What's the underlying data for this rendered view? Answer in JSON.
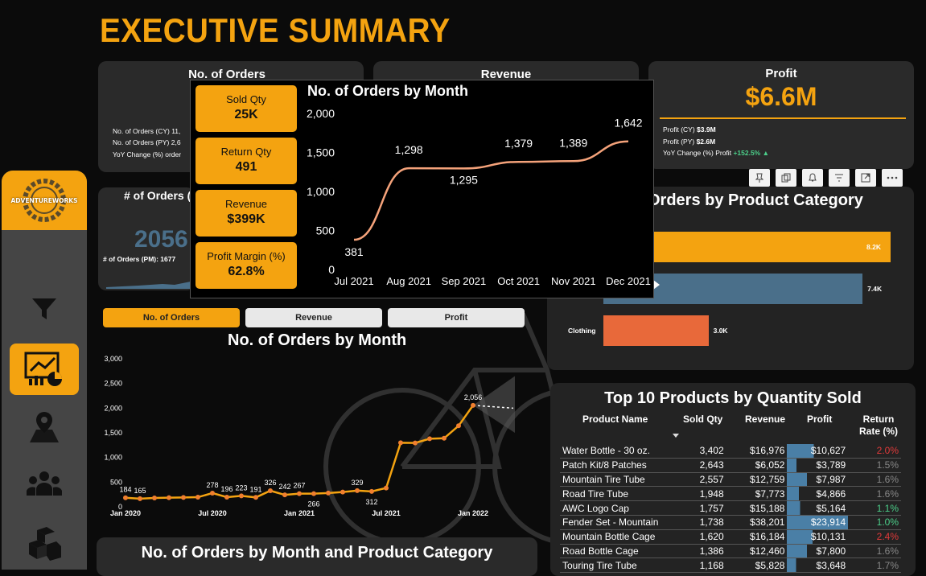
{
  "page_title": "EXECUTIVE SUMMARY",
  "cards": {
    "orders": {
      "title": "No. of Orders",
      "cy": "No. of Orders (CY) 11,",
      "py": "No. of Orders (PY) 2,6",
      "yoy": "YoY Change (%) order"
    },
    "revenue": {
      "title": "Revenue"
    },
    "profit": {
      "title": "Profit",
      "value": "$6.6M",
      "cy_label": "Profit (CY)",
      "cy_value": "$3.9M",
      "py_label": "Profit (PY)",
      "py_value": "$2.6M",
      "yoy_label": "YoY Change (%) Profit",
      "yoy_value": "+152.5% ▲"
    }
  },
  "month_card": {
    "title": "# of Orders (",
    "value": "2056",
    "pm": "# of Orders (PM): 1677"
  },
  "tooltip": {
    "kpis": [
      {
        "label": "Sold Qty",
        "value": "25K"
      },
      {
        "label": "Return Qty",
        "value": "491"
      },
      {
        "label": "Revenue",
        "value": "$399K"
      },
      {
        "label": "Profit Margin (%)",
        "value": "62.8%"
      }
    ]
  },
  "tabs": [
    {
      "label": "No. of Orders",
      "active": true
    },
    {
      "label": "Revenue",
      "active": false
    },
    {
      "label": "Profit",
      "active": false
    }
  ],
  "category_chart": {
    "title": "Orders by Product Category",
    "bars": [
      {
        "label": "",
        "value_label": "8.2K",
        "value": 8.2,
        "color": "#f4a310"
      },
      {
        "label": "",
        "value_label": "7.4K",
        "value": 7.4,
        "color": "#4a6f8a"
      },
      {
        "label": "Clothing",
        "value_label": "3.0K",
        "value": 3.0,
        "color": "#e8693a"
      }
    ]
  },
  "bottom_title": "No. of Orders by Month and Product Category",
  "top_products": {
    "title": "Top 10 Products by Quantity Sold",
    "headers": [
      "Product Name",
      "Sold Qty",
      "Revenue",
      "Profit",
      "Return Rate (%)"
    ],
    "rows": [
      {
        "name": "Water Bottle - 30 oz.",
        "qty": "3,402",
        "revenue": "$16,976",
        "profit": "$10,627",
        "profit_value": 10627,
        "rate": "2.0%",
        "rate_color": "#e03a3a"
      },
      {
        "name": "Patch Kit/8 Patches",
        "qty": "2,643",
        "revenue": "$6,052",
        "profit": "$3,789",
        "profit_value": 3789,
        "rate": "1.5%",
        "rate_color": "#888888"
      },
      {
        "name": "Mountain Tire Tube",
        "qty": "2,557",
        "revenue": "$12,759",
        "profit": "$7,987",
        "profit_value": 7987,
        "rate": "1.6%",
        "rate_color": "#888888"
      },
      {
        "name": "Road Tire Tube",
        "qty": "1,948",
        "revenue": "$7,773",
        "profit": "$4,866",
        "profit_value": 4866,
        "rate": "1.6%",
        "rate_color": "#888888"
      },
      {
        "name": "AWC Logo Cap",
        "qty": "1,757",
        "revenue": "$15,188",
        "profit": "$5,164",
        "profit_value": 5164,
        "rate": "1.1%",
        "rate_color": "#4ccf8a"
      },
      {
        "name": "Fender Set - Mountain",
        "qty": "1,738",
        "revenue": "$38,201",
        "profit": "$23,914",
        "profit_value": 23914,
        "rate": "1.0%",
        "rate_color": "#4ccf8a"
      },
      {
        "name": "Mountain Bottle Cage",
        "qty": "1,620",
        "revenue": "$16,184",
        "profit": "$10,131",
        "profit_value": 10131,
        "rate": "2.4%",
        "rate_color": "#e03a3a"
      },
      {
        "name": "Road Bottle Cage",
        "qty": "1,386",
        "revenue": "$12,460",
        "profit": "$7,800",
        "profit_value": 7800,
        "rate": "1.6%",
        "rate_color": "#888888"
      },
      {
        "name": "Touring Tire Tube",
        "qty": "1,168",
        "revenue": "$5,828",
        "profit": "$3,648",
        "profit_value": 3648,
        "rate": "1.7%",
        "rate_color": "#888888"
      }
    ]
  },
  "icons": {
    "filter": "filter-icon",
    "dashboard": "dashboard-icon",
    "map": "map-pin-icon",
    "customers": "people-icon",
    "products": "boxes-icon"
  },
  "logo_text": "ADVENTUREWORKS",
  "colors": {
    "accent": "#f4a310",
    "line_orange": "#f07f2f",
    "card_bg": "#2a2a2a"
  },
  "chart_data": [
    {
      "type": "line",
      "title": "No. of Orders by Month",
      "categories": [
        "Jul 2021",
        "Aug 2021",
        "Sep 2021",
        "Oct 2021",
        "Nov 2021",
        "Dec 2021"
      ],
      "values": [
        381,
        1298,
        1295,
        1379,
        1389,
        1642
      ],
      "yticks": [
        "0",
        "500",
        "1,000",
        "1,500",
        "2,000"
      ],
      "ylim": [
        0,
        2000
      ]
    },
    {
      "type": "line",
      "title": "No. of Orders by Month",
      "x_ticks": [
        "Jan 2020",
        "Jul 2020",
        "Jan 2021",
        "Jul 2021",
        "Jan 2022"
      ],
      "yticks": [
        "0",
        "500",
        "1,000",
        "1,500",
        "2,000",
        "2,500",
        "3,000"
      ],
      "ylim": [
        0,
        3000
      ],
      "values": [
        184,
        165,
        180,
        185,
        190,
        195,
        278,
        196,
        223,
        191,
        326,
        242,
        267,
        266,
        280,
        300,
        329,
        312,
        381,
        1298,
        1295,
        1379,
        1389,
        1642,
        2056
      ],
      "data_labels": {
        "0": "184",
        "1": "165",
        "6": "278",
        "7": "196",
        "8": "223",
        "9": "191",
        "10": "326",
        "11": "242",
        "12": "267",
        "13": "266",
        "16": "329",
        "17": "312",
        "24": "2,056"
      }
    }
  ]
}
